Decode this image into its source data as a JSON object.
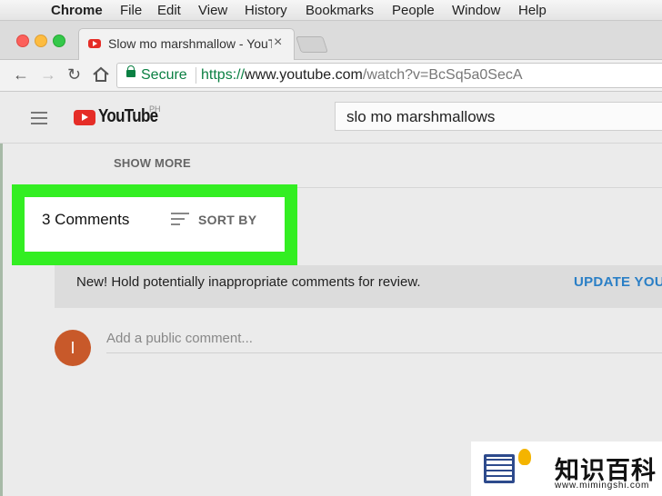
{
  "menubar": {
    "app": "Chrome",
    "items": [
      "File",
      "Edit",
      "View",
      "History",
      "Bookmarks",
      "People",
      "Window",
      "Help"
    ]
  },
  "tab": {
    "title": "Slow mo marshmallow - YouTube",
    "close": "×"
  },
  "toolbar": {
    "back": "←",
    "forward": "→",
    "reload": "↻",
    "secure_label": "Secure",
    "url_scheme": "https://",
    "url_host": "www.youtube.com",
    "url_path": "/watch?v=BcSq5a0SecA"
  },
  "youtube": {
    "logo_text": "YouTube",
    "country": "PH",
    "search_value": "slo mo marshmallows",
    "show_more": "SHOW MORE",
    "comments_count": "3 Comments",
    "sort_by": "SORT BY",
    "notice_text": "New! Hold potentially inappropriate comments for review.",
    "notice_link": "UPDATE YOUR",
    "avatar_letter": "I",
    "add_comment_placeholder": "Add a public comment..."
  },
  "watermark": {
    "text": "知识百科",
    "url": "www.mimingshi.com"
  },
  "colors": {
    "highlight": "#33ee22",
    "youtube_red": "#e52d27",
    "link_blue": "#2a7fc6",
    "secure_green": "#0b8043",
    "avatar": "#c8592a"
  }
}
